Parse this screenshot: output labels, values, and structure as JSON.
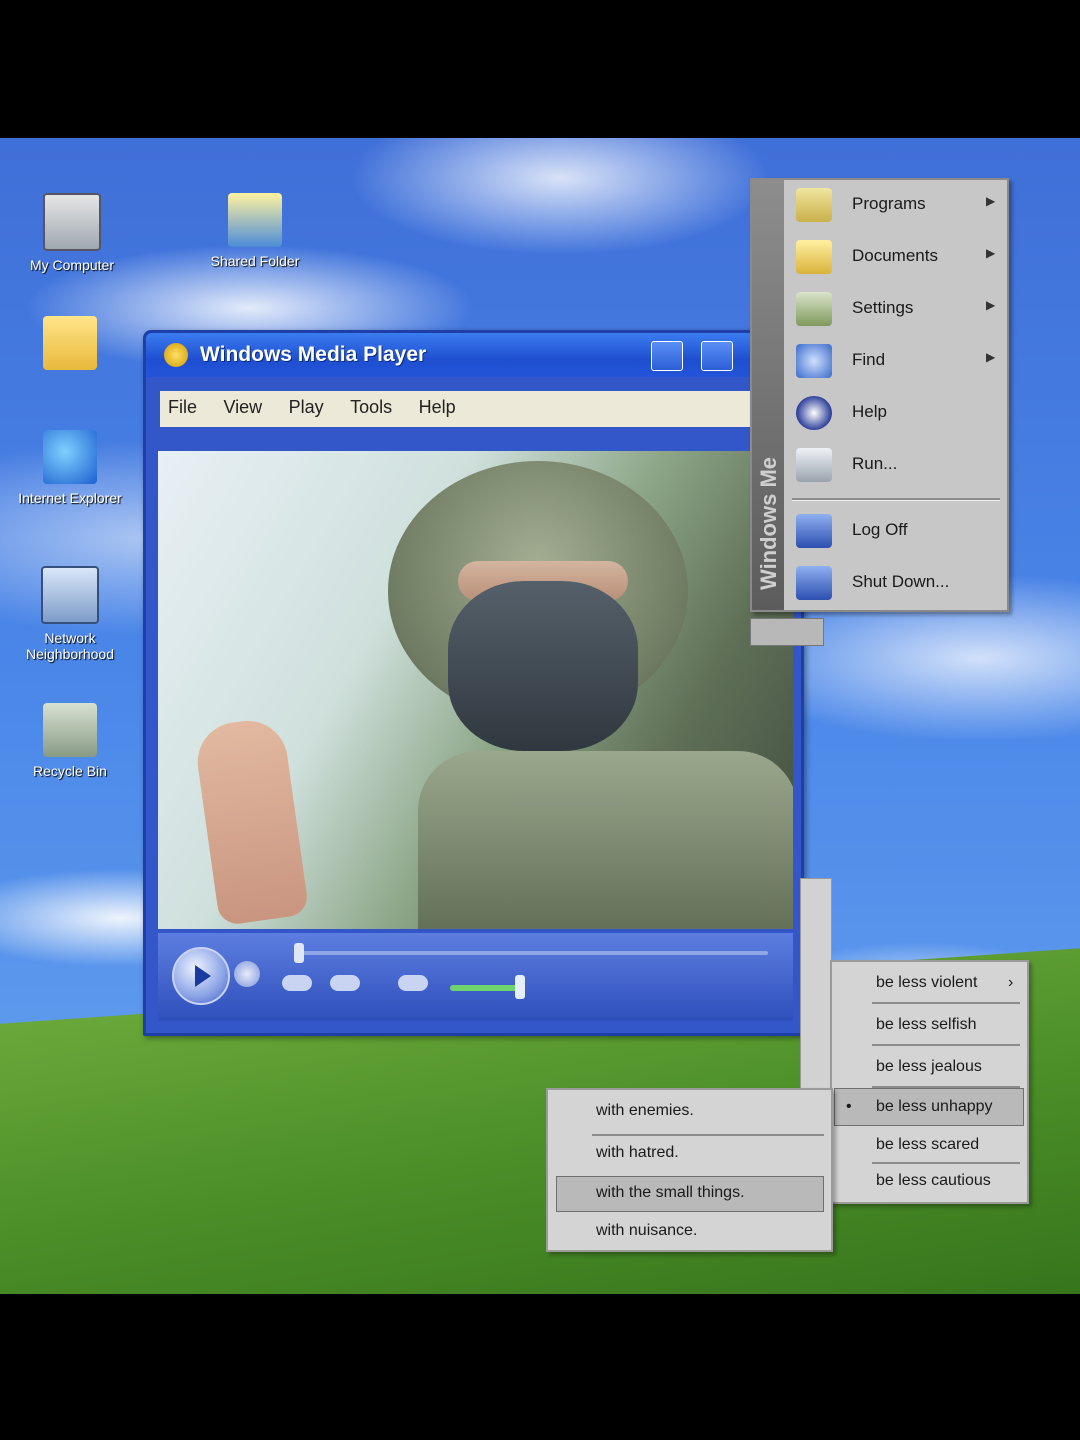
{
  "desktop_icons": [
    {
      "label": "My Computer",
      "icon": "computer-icon"
    },
    {
      "label": "Shared Folder",
      "icon": "shared-folder-icon"
    },
    {
      "label": "",
      "icon": "folder-icon"
    },
    {
      "label": "Internet Explorer",
      "icon": "internet-explorer-icon"
    },
    {
      "label": "Network Neighborhood",
      "icon": "network-icon"
    },
    {
      "label": "Recycle Bin",
      "icon": "recycle-bin-icon"
    }
  ],
  "player": {
    "title": "Windows Media Player",
    "menu": [
      "File",
      "View",
      "Play",
      "Tools",
      "Help"
    ]
  },
  "start_menu": {
    "side_label": "Windows Me",
    "items": [
      {
        "label": "Programs",
        "has_submenu": true
      },
      {
        "label": "Documents",
        "has_submenu": true
      },
      {
        "label": "Settings",
        "has_submenu": true
      },
      {
        "label": "Find",
        "has_submenu": true
      },
      {
        "label": "Help",
        "has_submenu": false
      },
      {
        "label": "Run...",
        "has_submenu": false
      },
      {
        "label": "Log Off",
        "has_submenu": false
      },
      {
        "label": "Shut Down...",
        "has_submenu": false
      }
    ]
  },
  "submenu_feelings": {
    "items": [
      "be less violent",
      "be less selfish",
      "be less jealous",
      "be less unhappy",
      "be less scared",
      "be less cautious"
    ],
    "selected_index": 3
  },
  "submenu_with": {
    "items": [
      "with enemies.",
      "with hatred.",
      "with the small things.",
      "with nuisance."
    ],
    "highlighted_index": 2
  },
  "colors": {
    "sky": "#4a86e8",
    "grass": "#4c8f28",
    "xp_title": "#2354d8",
    "menu_gray": "#c7c7c7"
  }
}
